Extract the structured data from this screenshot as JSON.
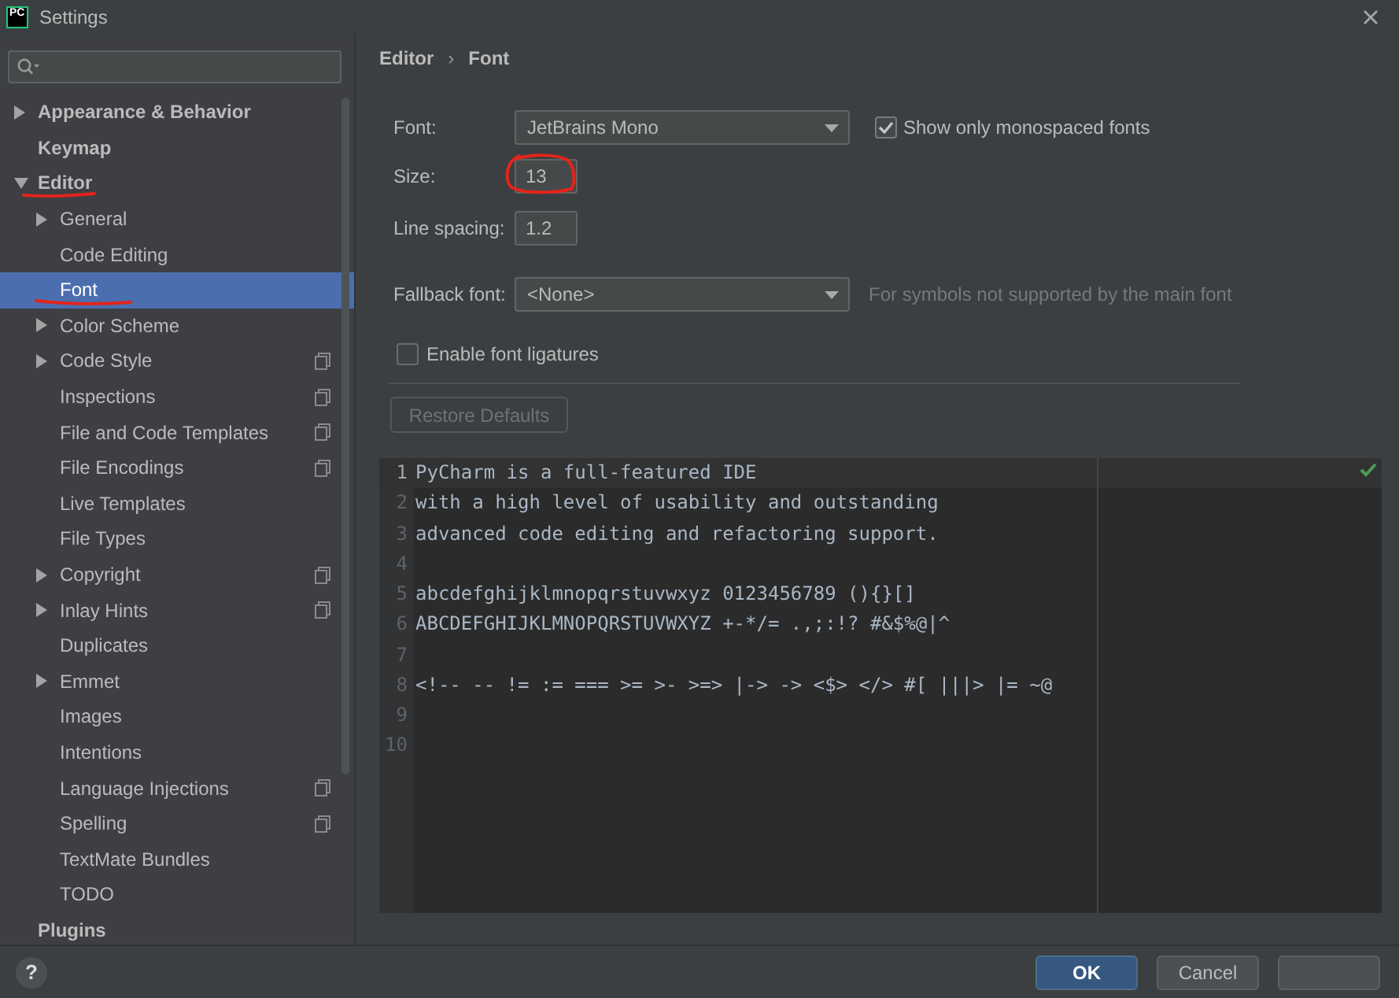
{
  "window": {
    "logo": "PC",
    "title": "Settings"
  },
  "sidebar": {
    "items": [
      {
        "label": "Appearance & Behavior",
        "expanded": false,
        "selected": false,
        "underlined": false
      },
      {
        "label": "Keymap",
        "selected": false,
        "underlined": false
      },
      {
        "label": "Editor",
        "expanded": true,
        "selected": false,
        "underlined": true,
        "children": [
          {
            "label": "General",
            "expanded": false,
            "selected": false,
            "underlined": false,
            "project_scope": false
          },
          {
            "label": "Code Editing",
            "selected": false,
            "underlined": false,
            "project_scope": false
          },
          {
            "label": "Font",
            "selected": true,
            "underlined": true,
            "project_scope": false
          },
          {
            "label": "Color Scheme",
            "expanded": false,
            "selected": false,
            "underlined": false,
            "project_scope": false
          },
          {
            "label": "Code Style",
            "expanded": false,
            "selected": false,
            "underlined": false,
            "project_scope": true
          },
          {
            "label": "Inspections",
            "selected": false,
            "underlined": false,
            "project_scope": true
          },
          {
            "label": "File and Code Templates",
            "selected": false,
            "underlined": false,
            "project_scope": true
          },
          {
            "label": "File Encodings",
            "selected": false,
            "underlined": false,
            "project_scope": true
          },
          {
            "label": "Live Templates",
            "selected": false,
            "underlined": false,
            "project_scope": false
          },
          {
            "label": "File Types",
            "selected": false,
            "underlined": false,
            "project_scope": false
          },
          {
            "label": "Copyright",
            "expanded": false,
            "selected": false,
            "underlined": false,
            "project_scope": true
          },
          {
            "label": "Inlay Hints",
            "expanded": false,
            "selected": false,
            "underlined": false,
            "project_scope": true
          },
          {
            "label": "Duplicates",
            "selected": false,
            "underlined": false,
            "project_scope": false
          },
          {
            "label": "Emmet",
            "expanded": false,
            "selected": false,
            "underlined": false,
            "project_scope": false
          },
          {
            "label": "Images",
            "selected": false,
            "underlined": false,
            "project_scope": false
          },
          {
            "label": "Intentions",
            "selected": false,
            "underlined": false,
            "project_scope": false
          },
          {
            "label": "Language Injections",
            "selected": false,
            "underlined": false,
            "project_scope": true
          },
          {
            "label": "Spelling",
            "selected": false,
            "underlined": false,
            "project_scope": true
          },
          {
            "label": "TextMate Bundles",
            "selected": false,
            "underlined": false,
            "project_scope": false
          },
          {
            "label": "TODO",
            "selected": false,
            "underlined": false,
            "project_scope": false
          }
        ]
      },
      {
        "label": "Plugins",
        "selected": false,
        "underlined": false
      }
    ]
  },
  "breadcrumb": {
    "items": [
      "Editor",
      "Font"
    ],
    "separator": "›"
  },
  "form": {
    "font": {
      "label": "Font:",
      "value": "JetBrains Mono"
    },
    "monospaced": {
      "label": "Show only monospaced fonts",
      "checked": true
    },
    "size": {
      "label": "Size:",
      "value": "13",
      "circled": true
    },
    "line_spacing": {
      "label": "Line spacing:",
      "value": "1.2"
    },
    "fallback_font": {
      "label": "Fallback font:",
      "value": "<None>",
      "hint": "For symbols not supported by the main font"
    },
    "ligatures": {
      "label": "Enable font ligatures",
      "checked": false
    },
    "restore_defaults": {
      "label": "Restore Defaults",
      "disabled": true
    }
  },
  "preview": {
    "lines": [
      {
        "number": "1",
        "text": "PyCharm is a full-featured IDE",
        "current": true
      },
      {
        "number": "2",
        "text": "with a high level of usability and outstanding",
        "current": false
      },
      {
        "number": "3",
        "text": "advanced code editing and refactoring support.",
        "current": false
      },
      {
        "number": "4",
        "current": false
      },
      {
        "number": "5",
        "text": "abcdefghijklmnopqrstuvwxyz 0123456789 (){}[]",
        "current": false
      },
      {
        "number": "6",
        "text": "ABCDEFGHIJKLMNOPQRSTUVWXYZ +-*/= .,;:!? #&$%@|^",
        "current": false
      },
      {
        "number": "7",
        "current": false
      },
      {
        "number": "8",
        "text": "<!-- -- != := === >= >- >=> |-> -> <$> </> #[ |||> |= ~@",
        "current": false
      },
      {
        "number": "9",
        "current": false
      },
      {
        "number": "10",
        "current": false
      }
    ]
  },
  "footer": {
    "help": "?",
    "buttons": [
      {
        "label": "OK",
        "kind": "primary"
      },
      {
        "label": "Cancel",
        "kind": "secondary"
      },
      {
        "kind": "secondary"
      }
    ]
  }
}
